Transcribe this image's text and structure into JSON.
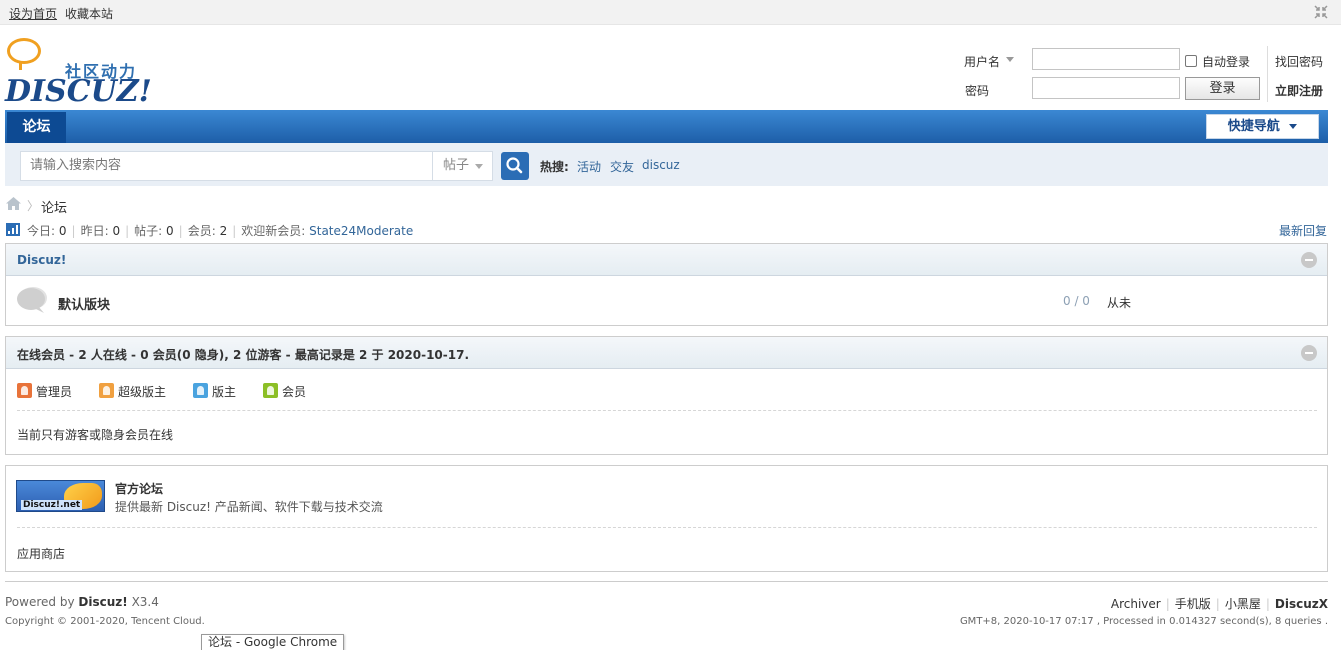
{
  "topbar": {
    "set_home": "设为首页",
    "bookmark": "收藏本站"
  },
  "logo": {
    "cn_text": "社区动力",
    "en_text": "DISCUZ!"
  },
  "login": {
    "username_label": "用户名",
    "password_label": "密码",
    "auto_login": "自动登录",
    "login_button": "登录",
    "forgot_password": "找回密码",
    "register": "立即注册"
  },
  "nav": {
    "forum_tab": "论坛",
    "quick_nav": "快捷导航"
  },
  "search": {
    "placeholder": "请输入搜索内容",
    "type": "帖子",
    "hot_label": "热搜:",
    "hot_items": [
      "活动",
      "交友",
      "discuz"
    ]
  },
  "breadcrumb": {
    "sep": "〉",
    "current": "论坛"
  },
  "stats": {
    "today_label": "今日:",
    "today": "0",
    "yesterday_label": "昨日:",
    "yesterday": "0",
    "posts_label": "帖子:",
    "posts": "0",
    "members_label": "会员:",
    "members": "2",
    "welcome_label": "欢迎新会员:",
    "newest_member": "State24Moderate",
    "latest_reply": "最新回复"
  },
  "category": {
    "title": "Discuz!",
    "forums": [
      {
        "name": "默认版块",
        "counts": "0 / 0",
        "last_post": "从未"
      }
    ]
  },
  "online": {
    "title": "在线会员 - 2 人在线 - 0 会员(0 隐身), 2 位游客 - 最高记录是 2 于 2020-10-17.",
    "roles": [
      {
        "label": "管理员",
        "color": "#e8733a"
      },
      {
        "label": "超级版主",
        "color": "#f0a040"
      },
      {
        "label": "版主",
        "color": "#4aa3df"
      },
      {
        "label": "会员",
        "color": "#8cbf26"
      }
    ],
    "note": "当前只有游客或隐身会员在线"
  },
  "links": {
    "logo_text": "Discuz!.net",
    "title": "官方论坛",
    "desc": "提供最新 Discuz! 产品新闻、软件下载与技术交流",
    "app_store": "应用商店"
  },
  "footer": {
    "powered_prefix": "Powered by",
    "powered_name": "Discuz!",
    "version": "X3.4",
    "copyright": "Copyright © 2001-2020, Tencent Cloud.",
    "links": [
      "Archiver",
      "手机版",
      "小黑屋"
    ],
    "brand": "DiscuzX",
    "gmt": "GMT+8, 2020-10-17 07:17 , Processed in 0.014327 second(s), 8 queries ."
  },
  "tooltip": "论坛 - Google Chrome"
}
